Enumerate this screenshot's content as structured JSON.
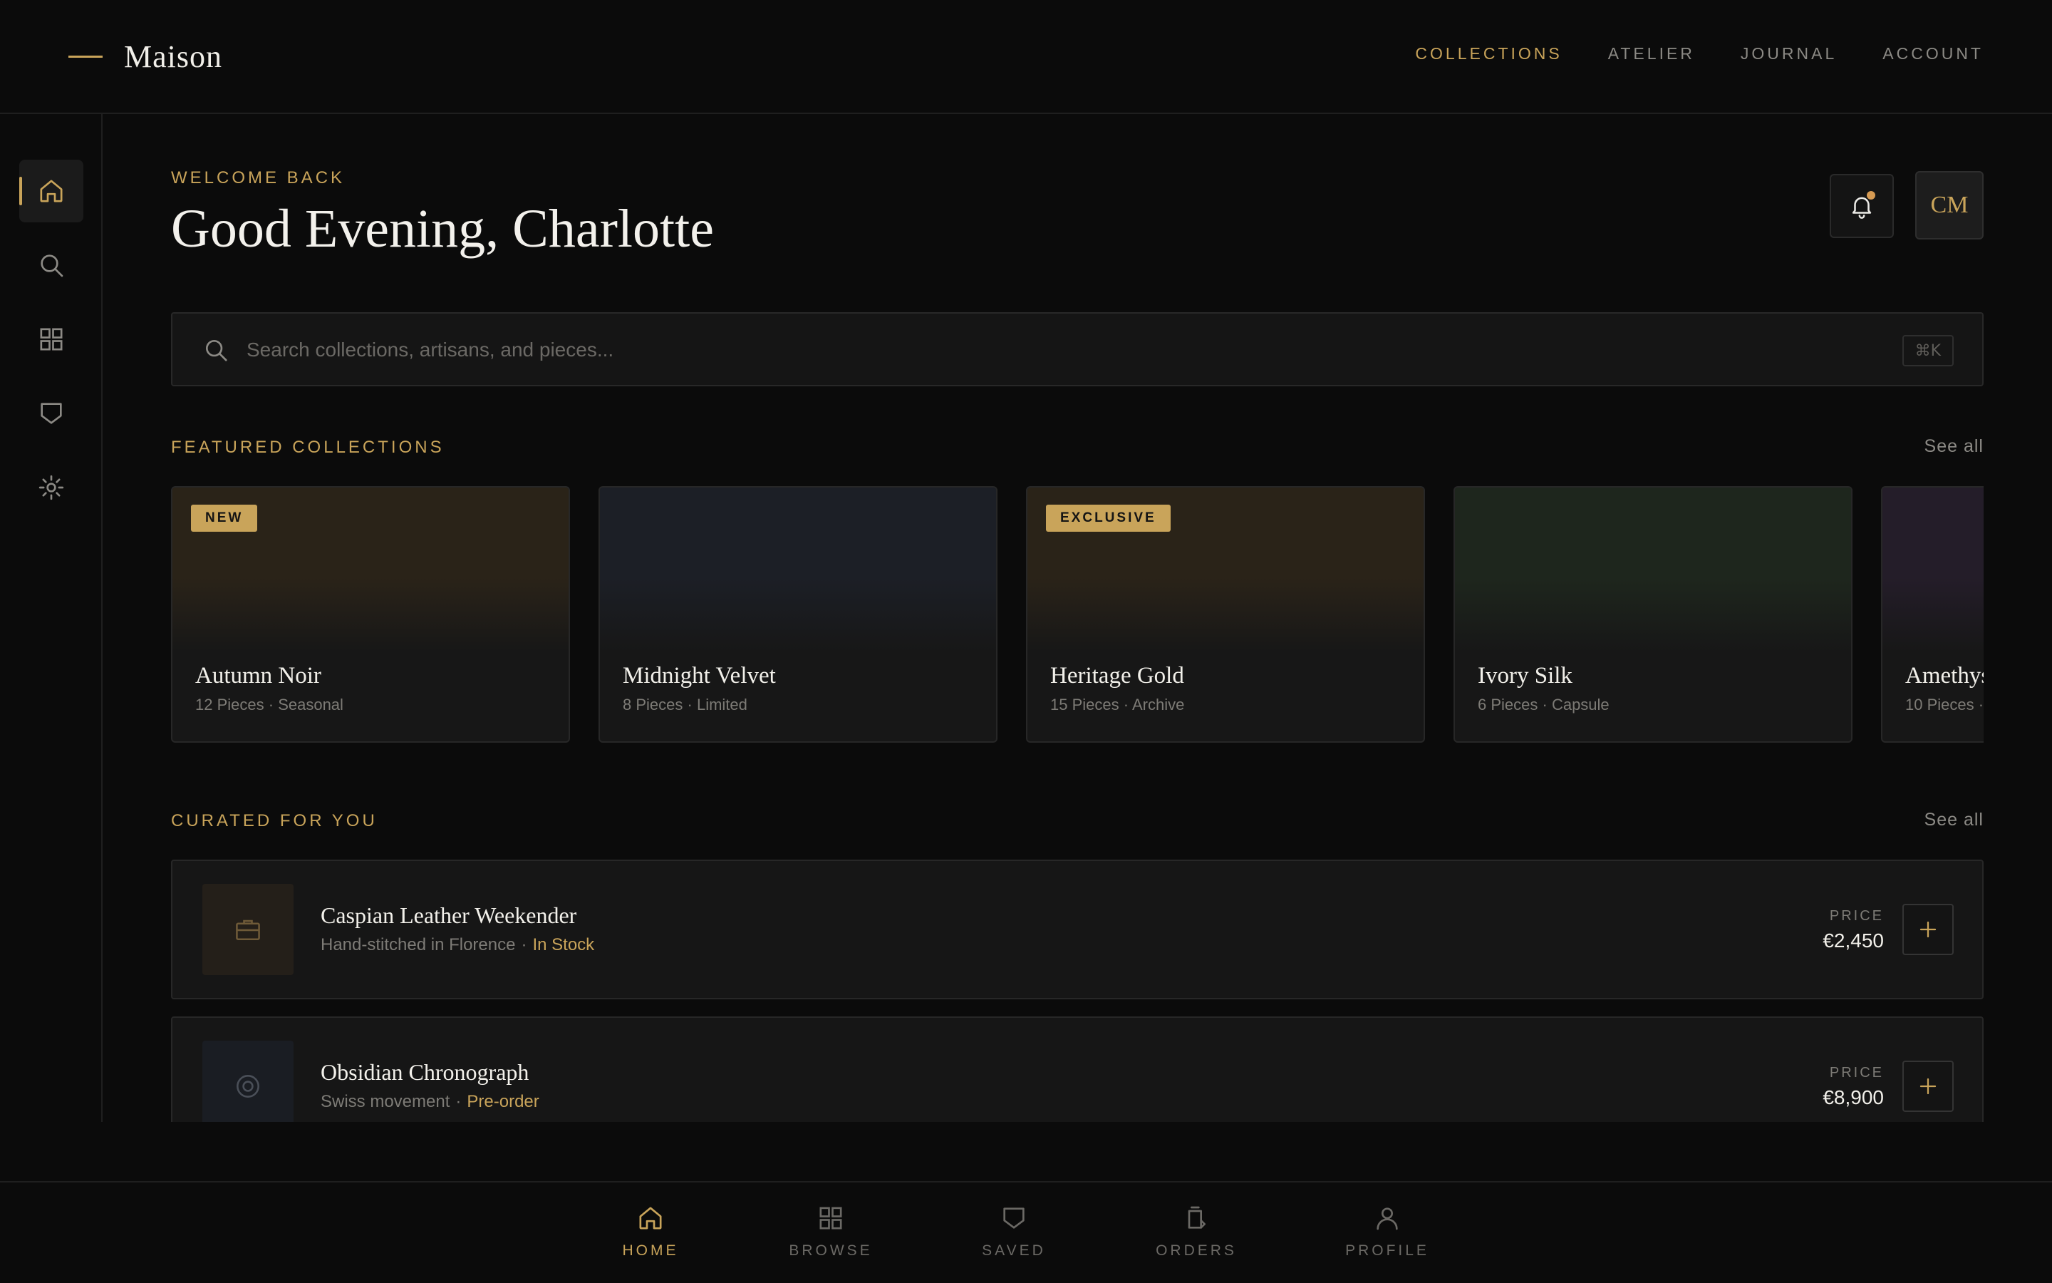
{
  "brand": {
    "name": "Maison"
  },
  "top_nav": [
    {
      "label": "COLLECTIONS",
      "active": true
    },
    {
      "label": "ATELIER",
      "active": false
    },
    {
      "label": "JOURNAL",
      "active": false
    },
    {
      "label": "ACCOUNT",
      "active": false
    }
  ],
  "rail": [
    "home-icon",
    "search-icon",
    "grid-icon",
    "shield-icon",
    "settings-icon"
  ],
  "header": {
    "eyebrow": "WELCOME BACK",
    "greeting": "Good Evening, Charlotte",
    "avatar_initials": "CM",
    "has_notification": true
  },
  "search": {
    "placeholder": "Search collections, artisans, and pieces...",
    "shortcut": "⌘K"
  },
  "featured": {
    "title": "FEATURED COLLECTIONS",
    "see_all": "See all",
    "cards": [
      {
        "title": "Autumn Noir",
        "pieces": "12 Pieces",
        "tag": "Seasonal",
        "badge": "NEW",
        "tint": "#2a2318"
      },
      {
        "title": "Midnight Velvet",
        "pieces": "8 Pieces",
        "tag": "Limited",
        "badge": "",
        "tint": "#1c1f26"
      },
      {
        "title": "Heritage Gold",
        "pieces": "15 Pieces",
        "tag": "Archive",
        "badge": "EXCLUSIVE",
        "tint": "#2a2318"
      },
      {
        "title": "Ivory Silk",
        "pieces": "6 Pieces",
        "tag": "Capsule",
        "badge": "",
        "tint": "#1e261d"
      },
      {
        "title": "Amethyst",
        "pieces": "10 Pieces",
        "tag": "",
        "badge": "",
        "tint": "#241d29"
      }
    ]
  },
  "curated": {
    "title": "CURATED FOR YOU",
    "see_all": "See all",
    "price_label": "PRICE",
    "items": [
      {
        "title": "Caspian Leather Weekender",
        "subtitle": "Hand-stitched in Florence",
        "status": "In Stock",
        "price": "€2,450",
        "icon": "briefcase-icon"
      },
      {
        "title": "Obsidian Chronograph",
        "subtitle": "Swiss movement",
        "status": "Pre-order",
        "price": "€8,900",
        "icon": "watch-icon"
      }
    ]
  },
  "bottom_nav": [
    {
      "label": "HOME",
      "icon": "home-icon",
      "active": true
    },
    {
      "label": "BROWSE",
      "icon": "grid-icon",
      "active": false
    },
    {
      "label": "SAVED",
      "icon": "shield-icon",
      "active": false
    },
    {
      "label": "ORDERS",
      "icon": "orders-icon",
      "active": false
    },
    {
      "label": "PROFILE",
      "icon": "user-icon",
      "active": false
    }
  ],
  "colors": {
    "accent": "#c9a45a",
    "background": "#0b0b0b",
    "surface": "#161616",
    "border": "#272727"
  }
}
